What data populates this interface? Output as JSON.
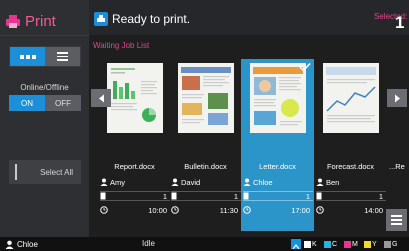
{
  "app": {
    "title": "Print",
    "title_icon": "printer-icon"
  },
  "sidebar": {
    "view_toggle": {
      "thumbnail_icon": "thumbnails-icon",
      "list_icon": "list-view-icon"
    },
    "online_offline": {
      "label": "Online/Offline",
      "on_label": "ON",
      "off_label": "OFF",
      "selected": "ON"
    },
    "select_all_label": "Select All"
  },
  "header": {
    "status_icon": "printer-status-icon",
    "status_text": "Ready to print.",
    "selected_label": "Selected:",
    "selected_count": "1"
  },
  "job_list": {
    "title": "Waiting Job List",
    "jobs": [
      {
        "file": "Report.docx",
        "user": "Amy",
        "pages": "1",
        "time": "10:00",
        "selected": false
      },
      {
        "file": "Bulletin.docx",
        "user": "David",
        "pages": "1",
        "time": "11:30",
        "selected": false
      },
      {
        "file": "Letter.docx",
        "user": "Chloe",
        "pages": "1",
        "time": "17:00",
        "selected": true
      },
      {
        "file": "Forecast.docx",
        "user": "Ben",
        "pages": "1",
        "time": "14:00",
        "selected": false
      },
      {
        "file": "...Re",
        "user": "",
        "pages": "",
        "time": "",
        "selected": false
      }
    ]
  },
  "footer": {
    "user": "Chloe",
    "status": "Idle",
    "toner": [
      {
        "label": "K",
        "color": "#ffffff"
      },
      {
        "label": "C",
        "color": "#2ab0e8"
      },
      {
        "label": "M",
        "color": "#e8338f"
      },
      {
        "label": "Y",
        "color": "#f2dc20"
      },
      {
        "label": "G",
        "color": "#9a9a9a"
      }
    ]
  },
  "colors": {
    "accent": "#1b8fd8",
    "highlight": "#e34590",
    "selected_card": "#2b94c9"
  }
}
